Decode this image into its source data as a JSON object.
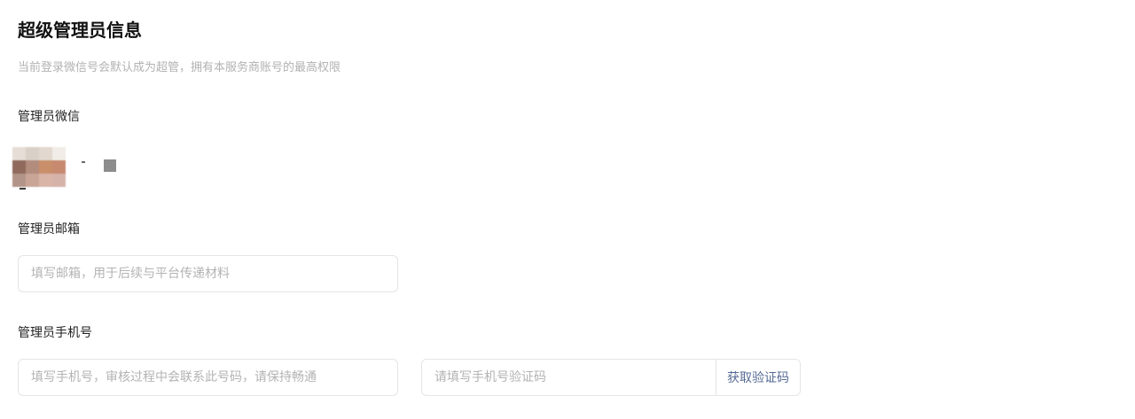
{
  "section": {
    "title": "超级管理员信息",
    "subtitle": "当前登录微信号会默认成为超管，拥有本服务商账号的最高权限"
  },
  "wechat": {
    "label": "管理员微信",
    "avatar_colors": [
      "#e6ddd6",
      "#d9d0c8",
      "#e2d8cf",
      "#f1ece7",
      "#8f6a5d",
      "#b28c7c",
      "#c98f6b",
      "#c78970",
      "#b29488",
      "#c9a598",
      "#d9b5a8",
      "#d6b3a8"
    ]
  },
  "email": {
    "label": "管理员邮箱",
    "placeholder": "填写邮箱，用于后续与平台传递材料",
    "value": ""
  },
  "phone": {
    "label": "管理员手机号",
    "placeholder": "填写手机号，审核过程中会联系此号码，请保持畅通",
    "value": "",
    "code_placeholder": "请填写手机号验证码",
    "code_button": "获取验证码"
  },
  "colors": {
    "accent": "#576b95",
    "placeholder": "#b3b3b3",
    "hint": "#b2b2b2",
    "border": "#e5e5e5"
  }
}
